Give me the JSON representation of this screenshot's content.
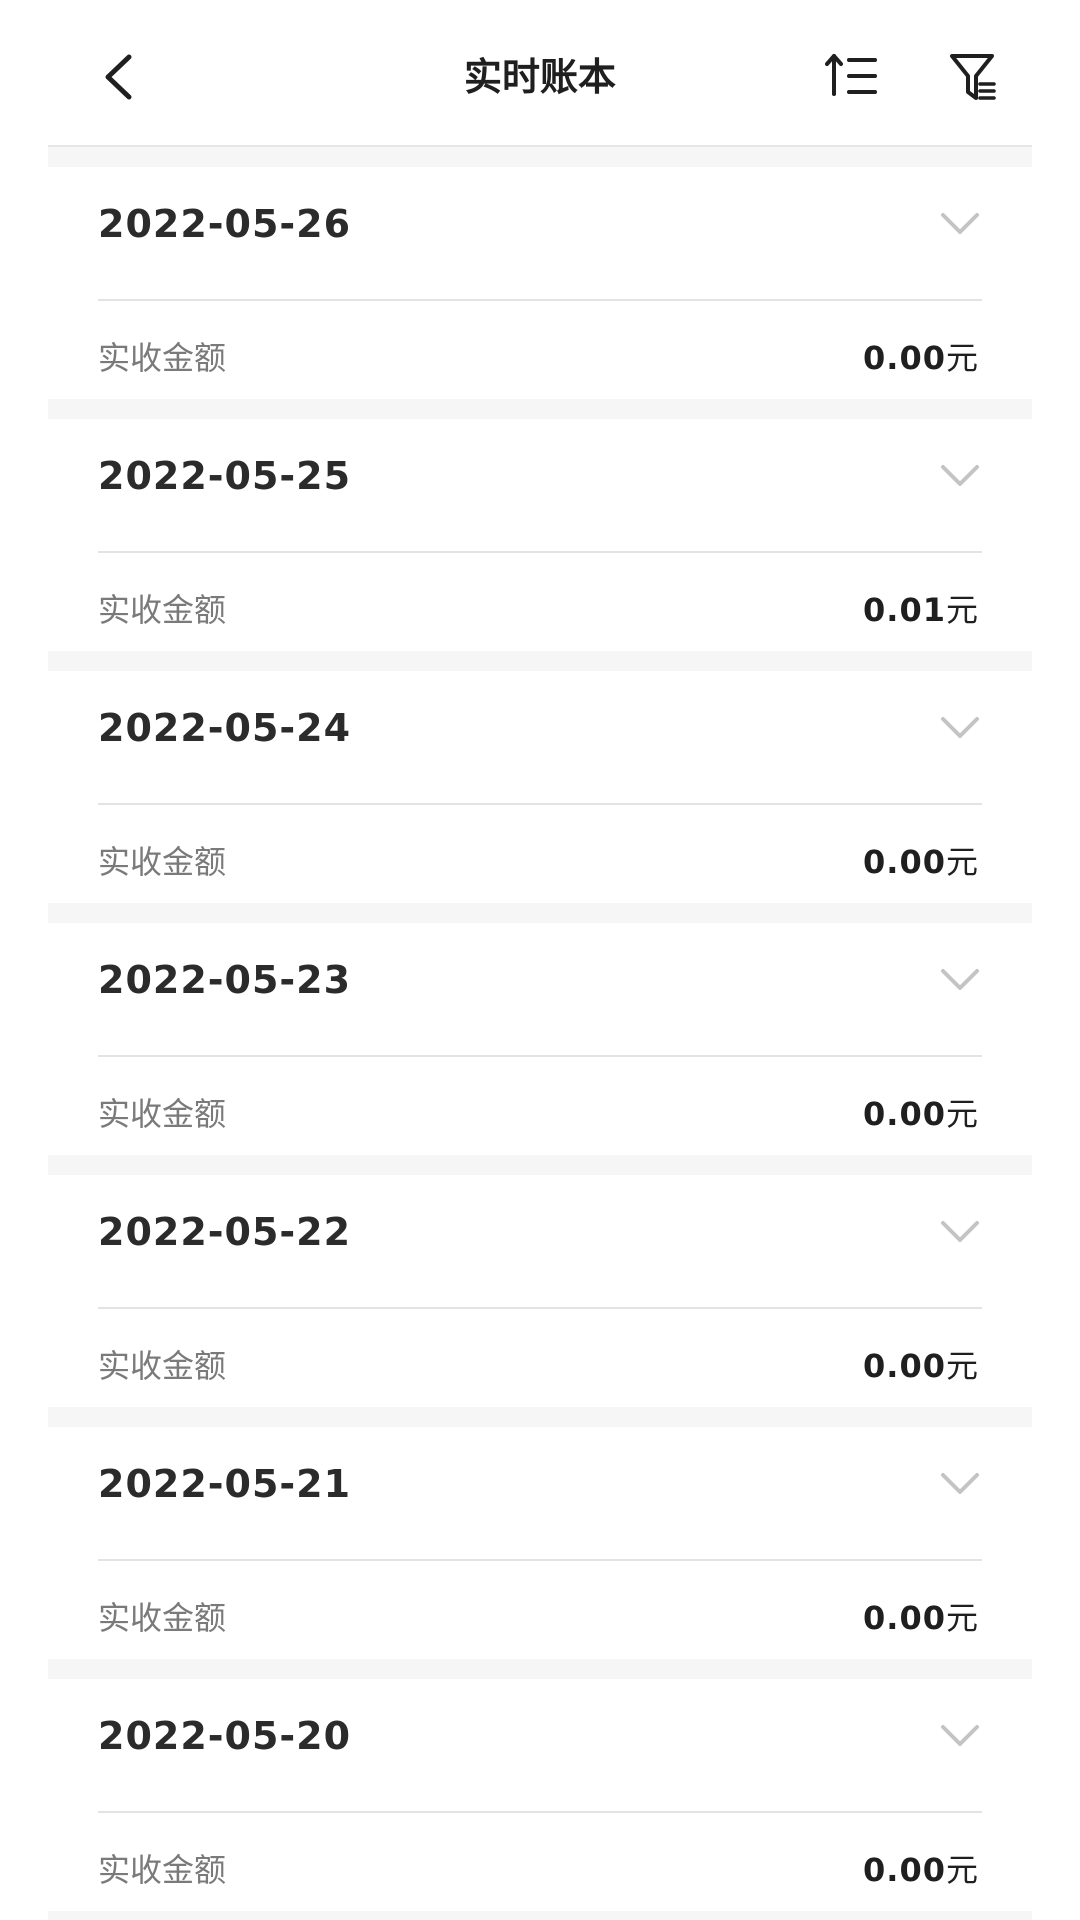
{
  "header": {
    "title": "实时账本",
    "back_icon": "chevron-left-icon",
    "sort_icon": "sort-ascending-icon",
    "filter_icon": "filter-list-icon"
  },
  "records": [
    {
      "date": "2022-05-26",
      "label": "实收金额",
      "amount": "0.00",
      "unit": "元"
    },
    {
      "date": "2022-05-25",
      "label": "实收金额",
      "amount": "0.01",
      "unit": "元"
    },
    {
      "date": "2022-05-24",
      "label": "实收金额",
      "amount": "0.00",
      "unit": "元"
    },
    {
      "date": "2022-05-23",
      "label": "实收金额",
      "amount": "0.00",
      "unit": "元"
    },
    {
      "date": "2022-05-22",
      "label": "实收金额",
      "amount": "0.00",
      "unit": "元"
    },
    {
      "date": "2022-05-21",
      "label": "实收金额",
      "amount": "0.00",
      "unit": "元"
    },
    {
      "date": "2022-05-20",
      "label": "实收金额",
      "amount": "0.00",
      "unit": "元"
    }
  ],
  "colors": {
    "background": "#ffffff",
    "separator": "#f6f6f6",
    "divider": "#e3e3e3",
    "chevron": "#c4c4c4",
    "text_primary": "#2b2b2b",
    "text_secondary": "#7a7a7a"
  }
}
